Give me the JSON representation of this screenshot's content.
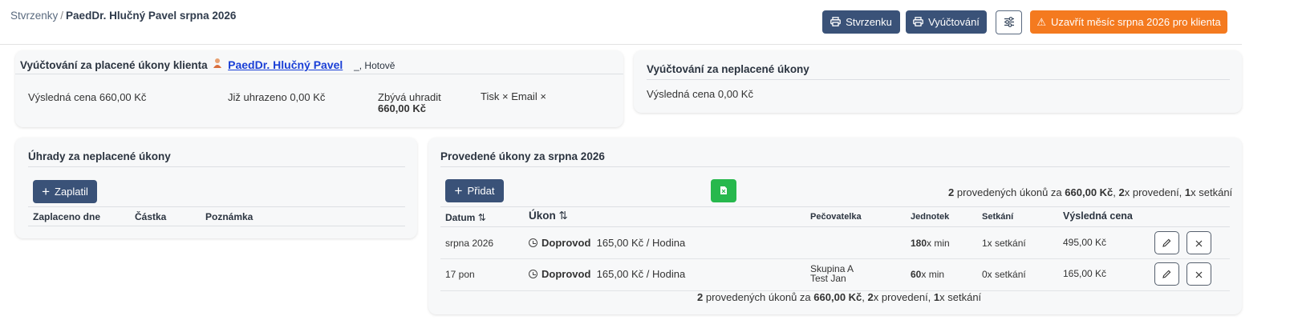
{
  "breadcrumb": {
    "root": "Stvrzenky",
    "separator": "/",
    "current": "PaedDr. Hlučný Pavel srpna 2026"
  },
  "toolbar": {
    "receipt_label": "Stvrzenku",
    "billing_label": "Vyúčtování",
    "close_month_label": "Uzavřít měsíc srpna 2026 pro klienta",
    "close_month_icon": "⚠"
  },
  "paid_card": {
    "title": "Vyúčtování za placené úkony klienta",
    "client_name": "PaedDr. Hlučný Pavel",
    "payment_type": "_, Hotově",
    "total_label": "Výsledná cena 660,00 Kč",
    "paid_label": "Již uhrazeno 0,00 Kč",
    "remaining_label": "Zbývá uhradit",
    "remaining_value": "660,00 Kč",
    "print_label": "Tisk",
    "email_label": "Email",
    "close_glyph": "×"
  },
  "unpaid_card": {
    "title": "Vyúčtování za neplacené úkony",
    "total_label": "Výsledná cena 0,00 Kč"
  },
  "payments_card": {
    "title": "Úhrady za neplacené úkony",
    "add_label": "Zaplatil",
    "columns": [
      "Zaplaceno dne",
      "Částka",
      "Poznámka"
    ]
  },
  "services_card": {
    "title": "Provedené úkony za srpna 2026",
    "add_label": "Přidat",
    "summary": {
      "count": "2",
      "t1": " provedených úkonů za ",
      "price": "660,00 Kč",
      "t2": ", ",
      "performed": "2",
      "t3": "x provedení, ",
      "meetings": "1",
      "t4": "x setkání"
    },
    "columns": {
      "date": "Datum",
      "service": "Úkon",
      "caregiver": "Pečovatelka",
      "units": "Jednotek",
      "meetings": "Setkání",
      "total": "Výsledná cena"
    },
    "sort_glyph": "⇅",
    "rows": [
      {
        "date": "srpna 2026",
        "service": "Doprovod",
        "rate": "165,00 Kč / Hodina",
        "caregiver_1": "",
        "caregiver_2": "",
        "units_num": "180",
        "units_unit": "x min",
        "meetings": "1x setkání",
        "total": "495,00 Kč"
      },
      {
        "date": "17 pon",
        "service": "Doprovod",
        "rate": "165,00 Kč / Hodina",
        "caregiver_1": "Skupina A",
        "caregiver_2": "Test Jan",
        "units_num": "60",
        "units_unit": "x min",
        "meetings": "0x setkání",
        "total": "165,00 Kč"
      }
    ]
  },
  "colors": {
    "navy": "#3a5278",
    "orange": "#f47a1f",
    "green": "#27b84d",
    "link": "#1a3fd6"
  }
}
